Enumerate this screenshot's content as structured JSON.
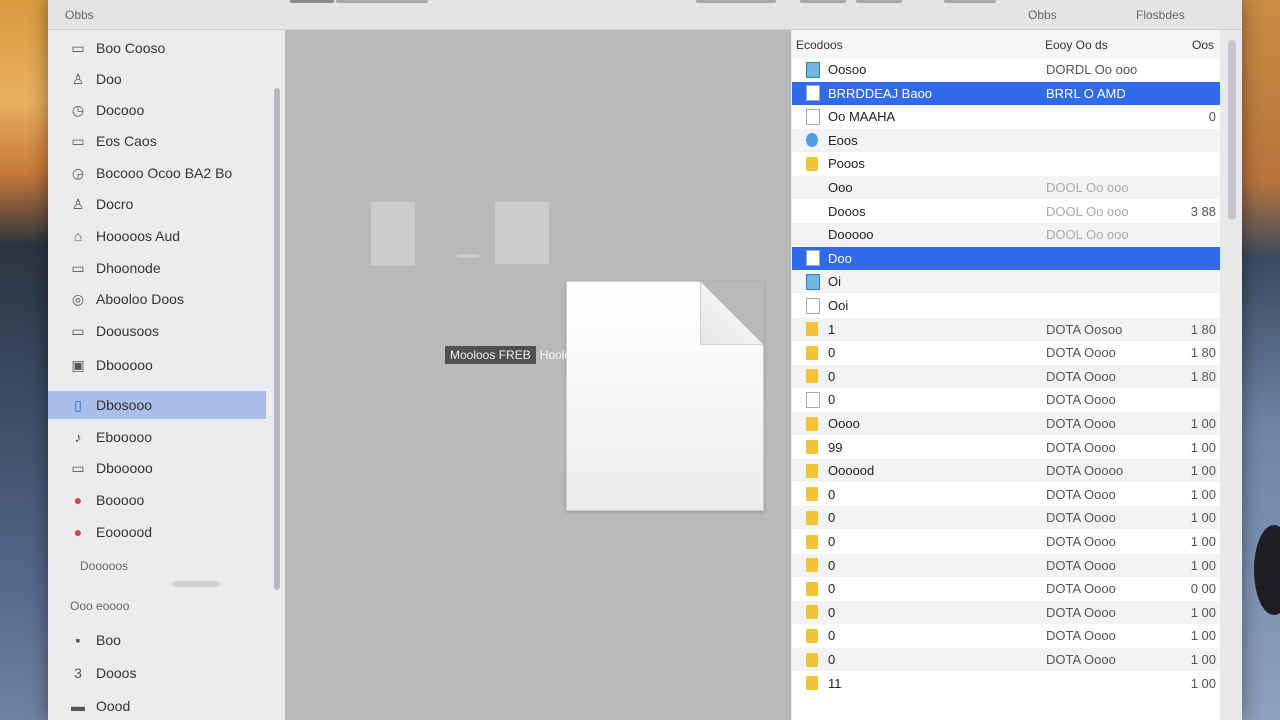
{
  "toolbar": {
    "title": "Obbs",
    "right_label_1": "Obbs",
    "right_label_2": "Flosbdes"
  },
  "sidebar": {
    "items": [
      {
        "label": "Boo Cooso",
        "icon": "box-icon"
      },
      {
        "label": "Doo",
        "icon": "person-icon"
      },
      {
        "label": "Docooo",
        "icon": "clock-icon"
      },
      {
        "label": "Eos Caos",
        "icon": "tray-icon"
      },
      {
        "label": "Bocooo Ocoo BA2 Bo",
        "icon": "recents-icon"
      },
      {
        "label": "Docro",
        "icon": "person-icon"
      },
      {
        "label": "Hooooos Aud",
        "icon": "home-icon"
      },
      {
        "label": "Dhoonode",
        "icon": "box-icon"
      },
      {
        "label": "Abooloo Doos",
        "icon": "disc-icon"
      },
      {
        "label": "Doousoos",
        "icon": "folder-icon"
      },
      {
        "label": "Dbooooo",
        "icon": "cube-icon"
      },
      {
        "label": "Dbosooo",
        "icon": "document-icon"
      },
      {
        "label": "Ebooooo",
        "icon": "music-note-icon"
      },
      {
        "label": "Dbooooo",
        "icon": "display-icon"
      },
      {
        "label": "Booooo",
        "icon": "tag-red-icon"
      },
      {
        "label": "Eoooood",
        "icon": "tag-red-icon"
      }
    ],
    "section_1": "Dooooos",
    "section_2": "Ooo eoooo",
    "items_2": [
      {
        "label": "Boo",
        "icon": "box-icon"
      },
      {
        "label": "Dooos",
        "icon": "number-icon"
      },
      {
        "label": "Oood",
        "icon": "disk-icon"
      }
    ]
  },
  "preview": {
    "tooltip_dark": "Mooloos FREB",
    "tooltip_light": "Hoolo oooo"
  },
  "list": {
    "columns": {
      "name": "Ecodoos",
      "date": "Eooy Oo ds",
      "size": "Oos"
    },
    "rows": [
      {
        "name": "Oosoo",
        "date": "DORDL Oo ooo",
        "size": "",
        "icon": "image-icon"
      },
      {
        "name": "BRRDDEAJ Baoo",
        "date": "BRRL O AMD",
        "size": "",
        "icon": "file-icon"
      },
      {
        "name": "Oo MAAHA",
        "date": "",
        "size": "0",
        "icon": "disk-icon"
      },
      {
        "name": "Eoos",
        "date": "",
        "size": "",
        "icon": "globe-icon"
      },
      {
        "name": "Pooos",
        "date": "",
        "size": "",
        "icon": "folder-icon"
      },
      {
        "name": "Ooo",
        "date": "DOOL Oo ooo",
        "size": "",
        "icon": ""
      },
      {
        "name": "Dooos",
        "date": "DOOL Oo ooo",
        "size": "3 88",
        "icon": ""
      },
      {
        "name": "Dooooo",
        "date": "DOOL Oo ooo",
        "size": "",
        "icon": ""
      },
      {
        "name": "Doo",
        "date": "",
        "size": "",
        "icon": "file-icon"
      },
      {
        "name": "Oi",
        "date": "",
        "size": "",
        "icon": "image-icon"
      },
      {
        "name": "Ooi",
        "date": "",
        "size": "",
        "icon": "file-icon"
      },
      {
        "name": "1",
        "date": "DOTA Oosoo",
        "size": "1 80",
        "icon": "folder-icon"
      },
      {
        "name": "0",
        "date": "DOTA Oooo",
        "size": "1 80",
        "icon": "folder-icon"
      },
      {
        "name": "0",
        "date": "DOTA Oooo",
        "size": "1 80",
        "icon": "folder-icon"
      },
      {
        "name": "0",
        "date": "DOTA Oooo",
        "size": "",
        "icon": "file-icon"
      },
      {
        "name": "Oooo",
        "date": "DOTA Oooo",
        "size": "1 00",
        "icon": "folder-icon"
      },
      {
        "name": "99",
        "date": "DOTA Oooo",
        "size": "1 00",
        "icon": "folder-icon"
      },
      {
        "name": "Oooood",
        "date": "DOTA Ooooo",
        "size": "1 00",
        "icon": "folder-icon"
      },
      {
        "name": "0",
        "date": "DOTA Oooo",
        "size": "1 00",
        "icon": "folder-icon"
      },
      {
        "name": "0",
        "date": "DOTA Oooo",
        "size": "1 00",
        "icon": "folder-icon"
      },
      {
        "name": "0",
        "date": "DOTA Oooo",
        "size": "1 00",
        "icon": "folder-icon"
      },
      {
        "name": "0",
        "date": "DOTA Oooo",
        "size": "1 00",
        "icon": "folder-icon"
      },
      {
        "name": "0",
        "date": "DOTA Oooo",
        "size": "0 00",
        "icon": "folder-icon"
      },
      {
        "name": "0",
        "date": "DOTA Oooo",
        "size": "1 00",
        "icon": "folder-icon"
      },
      {
        "name": "0",
        "date": "DOTA Oooo",
        "size": "1 00",
        "icon": "folder-icon"
      },
      {
        "name": "0",
        "date": "DOTA Oooo",
        "size": "1 00",
        "icon": "folder-icon"
      },
      {
        "name": "11",
        "date": "",
        "size": "1 00",
        "icon": "folder-icon"
      }
    ],
    "selected_rows": [
      1,
      8
    ]
  }
}
